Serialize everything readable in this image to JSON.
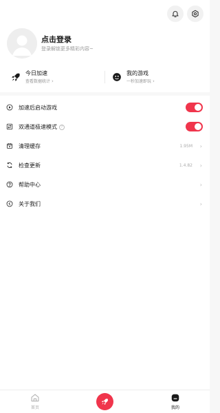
{
  "header": {
    "icons": [
      "bell-icon",
      "settings-icon"
    ]
  },
  "profile": {
    "login_title": "点击登录",
    "login_subtitle": "登录解锁更多精彩内容~"
  },
  "quick_cards": [
    {
      "title": "今日加速",
      "subtitle": "查看数据统计",
      "chevron": "›",
      "icon": "rocket-icon"
    },
    {
      "title": "我的游戏",
      "subtitle": "一秒加速即玩",
      "chevron": "›",
      "icon": "game-controller-icon"
    }
  ],
  "menu": {
    "items": [
      {
        "label": "加速后启动游戏",
        "icon": "launch-icon",
        "toggle_on": true
      },
      {
        "label": "双通道极速模式",
        "icon": "dual-channel-icon",
        "help": "?",
        "toggle_on": true
      },
      {
        "label": "清理缓存",
        "icon": "clear-cache-icon",
        "value": "1.95M",
        "chevron": "›"
      },
      {
        "label": "检查更新",
        "icon": "refresh-icon",
        "value": "1.4.82",
        "chevron": "›"
      },
      {
        "label": "帮助中心",
        "icon": "help-icon",
        "chevron": "›"
      },
      {
        "label": "关于我们",
        "icon": "info-icon",
        "chevron": "›"
      }
    ]
  },
  "tabbar": {
    "home_label": "首页",
    "mine_label": "我的",
    "center_icon": "rocket-icon"
  },
  "colors": {
    "accent": "#f0354c",
    "background": "#f7f7f7",
    "text_primary": "#222222",
    "text_secondary": "#999999"
  }
}
